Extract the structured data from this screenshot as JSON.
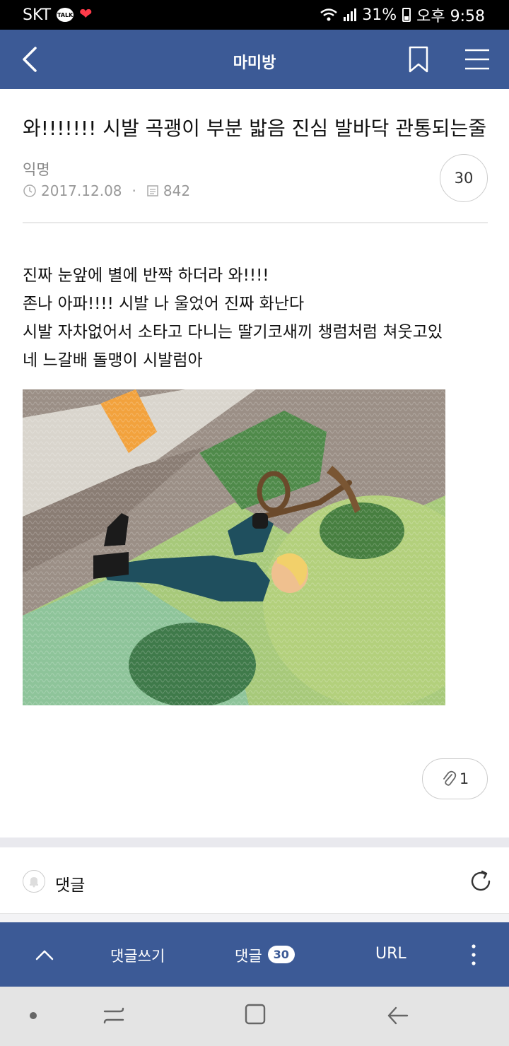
{
  "status_bar": {
    "carrier": "SKT",
    "talk_badge": "TALK",
    "battery": "31%",
    "time": "오후 9:58"
  },
  "header": {
    "title": "마미방",
    "icons": [
      "back-arrow-icon",
      "bookmark-icon",
      "hamburger-menu-icon"
    ]
  },
  "post": {
    "title": "와!!!!!!! 시발 곡괭이 부분 밟음 진심 발바닥 관통되는줄",
    "author": "익명",
    "date": "2017.12.08",
    "separator": "·",
    "views": "842",
    "comment_count": "30",
    "body_lines": [
      "진짜 눈앞에 별에 반짝 하더라 와!!!!",
      "존나 아파!!!! 시발 나 울었어 진짜 화난다",
      "시발 자차없어서 소타고 다니는 딸기코새끼 챙럼처럼 쳐웃고있",
      "네 느갈배 돌맹이 시발럼아"
    ],
    "attachment_count": "1"
  },
  "comments_section": {
    "label": "댓글"
  },
  "action_bar": {
    "write_comment": "댓글쓰기",
    "comments_label": "댓글",
    "comments_badge": "30",
    "url": "URL"
  },
  "colors": {
    "brand": "#3c5a96",
    "status_bar": "#000000",
    "nav_bar": "#e4e4e4"
  }
}
